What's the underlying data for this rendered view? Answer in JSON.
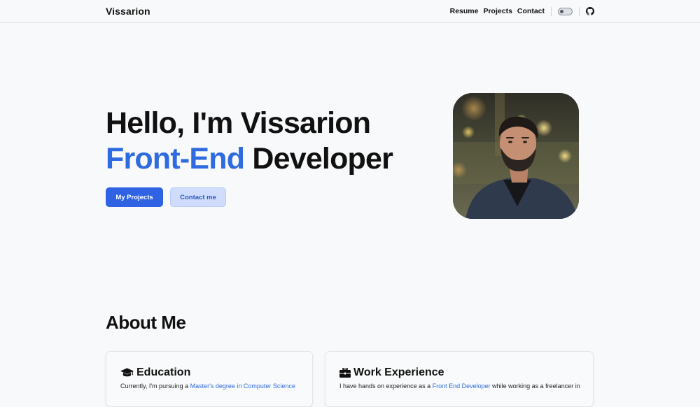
{
  "navbar": {
    "brand": "Vissarion",
    "links": [
      "Resume",
      "Projects",
      "Contact"
    ],
    "theme_toggle_icon": "toggle-icon",
    "github_icon": "github-icon"
  },
  "hero": {
    "greeting": "Hello, I'm Vissarion",
    "role_accent": "Front-End",
    "role_rest": " Developer",
    "primary_button": "My Projects",
    "secondary_button": "Contact me",
    "accent_color": "#2f6be0"
  },
  "about": {
    "title": "About Me",
    "education": {
      "icon": "graduation-cap-icon",
      "heading": "Education",
      "text_before": "Currently, I'm pursuing a ",
      "text_link": "Master's degree in Computer Science"
    },
    "work": {
      "icon": "briefcase-icon",
      "heading": "Work Experience",
      "text_before": "I have hands on experience as a ",
      "text_link": "Front End Developer",
      "text_after": " while working as a freelancer in"
    }
  }
}
